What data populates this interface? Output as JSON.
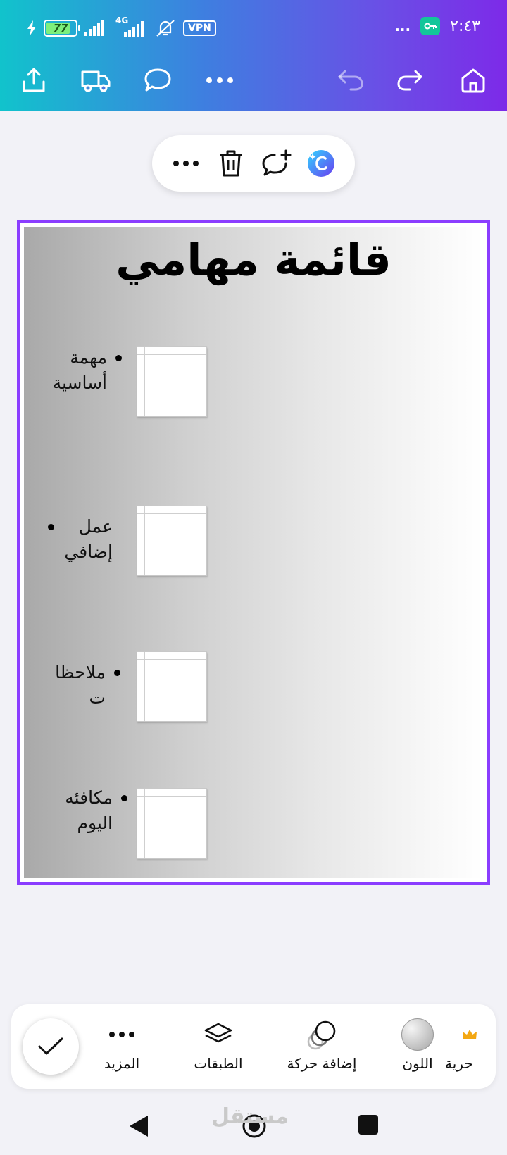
{
  "status_bar": {
    "battery": "77",
    "network": "4G",
    "vpn": "VPN",
    "time": "٢:٤٣",
    "more": "..."
  },
  "toolbar_icons": [
    "share-icon",
    "truck-icon",
    "comment-icon",
    "more-icon",
    "undo-icon",
    "redo-icon",
    "home-icon"
  ],
  "pill_icons": [
    "more-icon",
    "trash-icon",
    "add-comment-icon",
    "canva-magic-icon"
  ],
  "design": {
    "title": "قائمة مهامي",
    "tasks": [
      {
        "label": "مهمة أساسية"
      },
      {
        "label": "عمل إضافي"
      },
      {
        "label": "ملاحظات"
      },
      {
        "label": "مكافئه اليوم"
      }
    ]
  },
  "bottom_toolbar": {
    "more": "المزيد",
    "layers": "الطبقات",
    "animate": "إضافة حركة",
    "color": "اللون",
    "premium": "حرية"
  },
  "watermark": "مستقل"
}
